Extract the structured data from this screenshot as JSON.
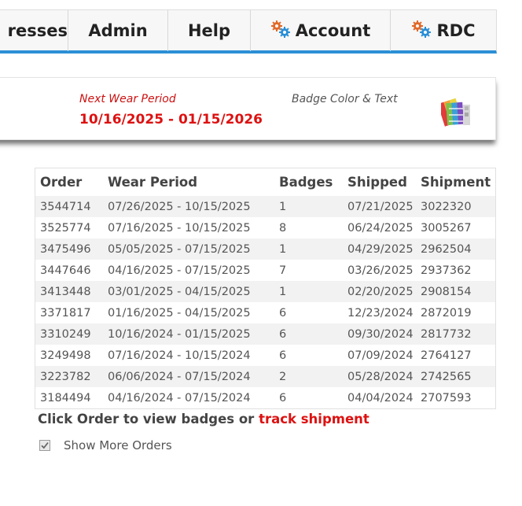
{
  "nav": {
    "items": [
      {
        "label": "resses",
        "icon": null
      },
      {
        "label": "Admin",
        "icon": null
      },
      {
        "label": "Help",
        "icon": null
      },
      {
        "label": "Account",
        "icon": "gear-icon"
      },
      {
        "label": "RDC",
        "icon": "gear-icon"
      }
    ],
    "accent_color": "#2b8fd6"
  },
  "card": {
    "next_wear_label": "Next Wear Period",
    "next_wear_value": "10/16/2025 - 01/15/2026",
    "badge_label": "Badge Color & Text",
    "badge_icon": "color-palette-icon",
    "highlight_color": "#dd1111"
  },
  "orders": {
    "headers": [
      "Order",
      "Wear Period",
      "Badges",
      "Shipped",
      "Shipment"
    ],
    "rows": [
      [
        "3544714",
        "07/26/2025 - 10/15/2025",
        "1",
        "07/21/2025",
        "3022320"
      ],
      [
        "3525774",
        "07/16/2025 - 10/15/2025",
        "8",
        "06/24/2025",
        "3005267"
      ],
      [
        "3475496",
        "05/05/2025 - 07/15/2025",
        "1",
        "04/29/2025",
        "2962504"
      ],
      [
        "3447646",
        "04/16/2025 - 07/15/2025",
        "7",
        "03/26/2025",
        "2937362"
      ],
      [
        "3413448",
        "03/01/2025 - 04/15/2025",
        "1",
        "02/20/2025",
        "2908154"
      ],
      [
        "3371817",
        "01/16/2025 - 04/15/2025",
        "6",
        "12/23/2024",
        "2872019"
      ],
      [
        "3310249",
        "10/16/2024 - 01/15/2025",
        "6",
        "09/30/2024",
        "2817732"
      ],
      [
        "3249498",
        "07/16/2024 - 10/15/2024",
        "6",
        "07/09/2024",
        "2764127"
      ],
      [
        "3223782",
        "06/06/2024 - 07/15/2024",
        "2",
        "05/28/2024",
        "2742565"
      ],
      [
        "3184494",
        "04/16/2024 - 07/15/2024",
        "6",
        "04/04/2024",
        "2707593"
      ]
    ]
  },
  "footer": {
    "hint_text": "Click Order to view badges or ",
    "track_link": "track shipment",
    "show_more_label": "Show More Orders",
    "show_more_checked": true
  }
}
